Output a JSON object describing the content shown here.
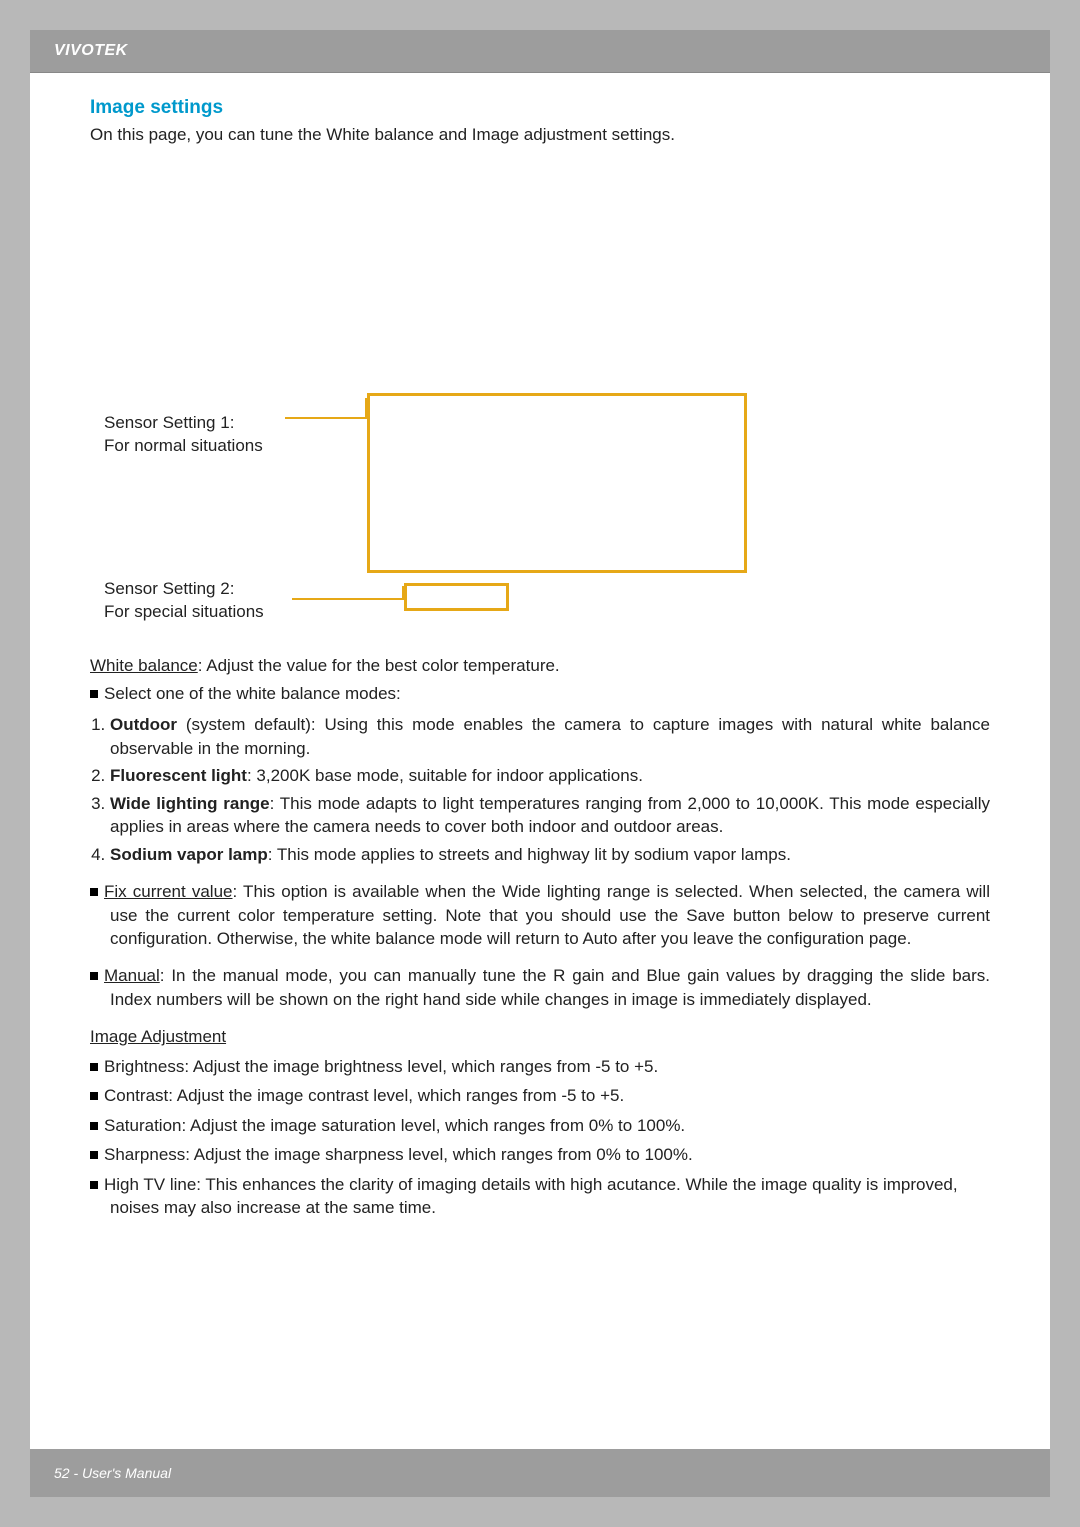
{
  "brand": "VIVOTEK",
  "section_title": "Image settings",
  "intro": "On this page, you can tune the White balance and Image adjustment settings.",
  "sensor1_line1": "Sensor Setting 1:",
  "sensor1_line2": "For normal situations",
  "sensor2_line1": "Sensor Setting 2:",
  "sensor2_line2": "For special situations",
  "wb_heading": "White balance",
  "wb_intro": ": Adjust the value for the best color temperature.",
  "wb_select": "Select one of the white balance modes:",
  "modes": {
    "m1_bold": "Outdoor",
    "m1_rest": " (system default): Using this mode enables the camera to capture images with natural white balance observable in the morning.",
    "m2_bold": "Fluorescent light",
    "m2_rest": ": 3,200K base mode, suitable for indoor applications.",
    "m3_bold": "Wide lighting range",
    "m3_rest": ": This mode adapts to light temperatures ranging from 2,000 to 10,000K. This mode especially applies in areas where the camera needs to cover both indoor and outdoor areas.",
    "m4_bold": "Sodium vapor lamp",
    "m4_rest": ": This mode applies to streets and highway lit by sodium vapor lamps."
  },
  "fix_heading": "Fix current value",
  "fix_text": ": This option is available when the Wide lighting range is selected. When selected, the camera will use the current color temperature setting. Note that you should use the Save button below to preserve current configuration. Otherwise, the white balance mode will return to Auto after you leave the configuration page.",
  "manual_heading": "Manual",
  "manual_text": ": In the manual mode, you can manually tune the R gain and Blue gain values by dragging the slide bars. Index numbers will be shown on the right hand side while changes in image is immediately displayed.",
  "adj_heading": "Image Adjustment",
  "adj_items": {
    "a1": "Brightness: Adjust the image brightness level, which ranges from -5 to +5.",
    "a2": "Contrast: Adjust the image contrast level, which ranges from -5 to +5.",
    "a3": "Saturation: Adjust the image saturation level, which ranges from 0% to 100%.",
    "a4": "Sharpness: Adjust the image sharpness level, which ranges from 0% to 100%.",
    "a5": "High TV line: This enhances the clarity of imaging details with high acutance. While the image quality is improved, noises may also increase at the same time."
  },
  "footer": "52 - User's Manual"
}
